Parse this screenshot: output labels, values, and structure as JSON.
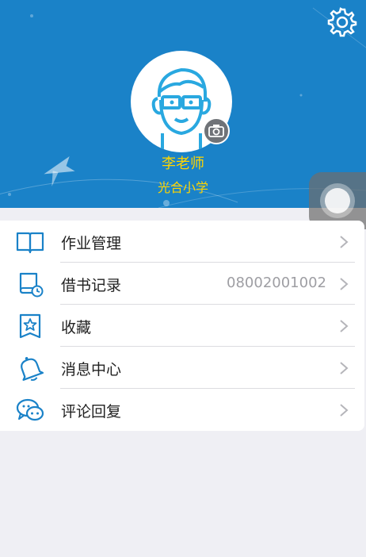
{
  "profile": {
    "name": "李老师",
    "school": "光合小学"
  },
  "menu": [
    {
      "label": "作业管理",
      "value": ""
    },
    {
      "label": "借书记录",
      "value": "08002001002"
    },
    {
      "label": "收藏",
      "value": ""
    },
    {
      "label": "消息中心",
      "value": ""
    },
    {
      "label": "评论回复",
      "value": ""
    }
  ],
  "icons": {
    "settings": "gear-icon",
    "camera": "camera-icon",
    "homework": "book-icon",
    "borrow": "book-clock-icon",
    "favorite": "star-icon",
    "messages": "bell-icon",
    "comments": "chat-icon",
    "chevron": "chevron-right-icon"
  },
  "colors": {
    "header": "#1a82c8",
    "name_text": "#ffd500",
    "icon_blue": "#1a82c8"
  }
}
